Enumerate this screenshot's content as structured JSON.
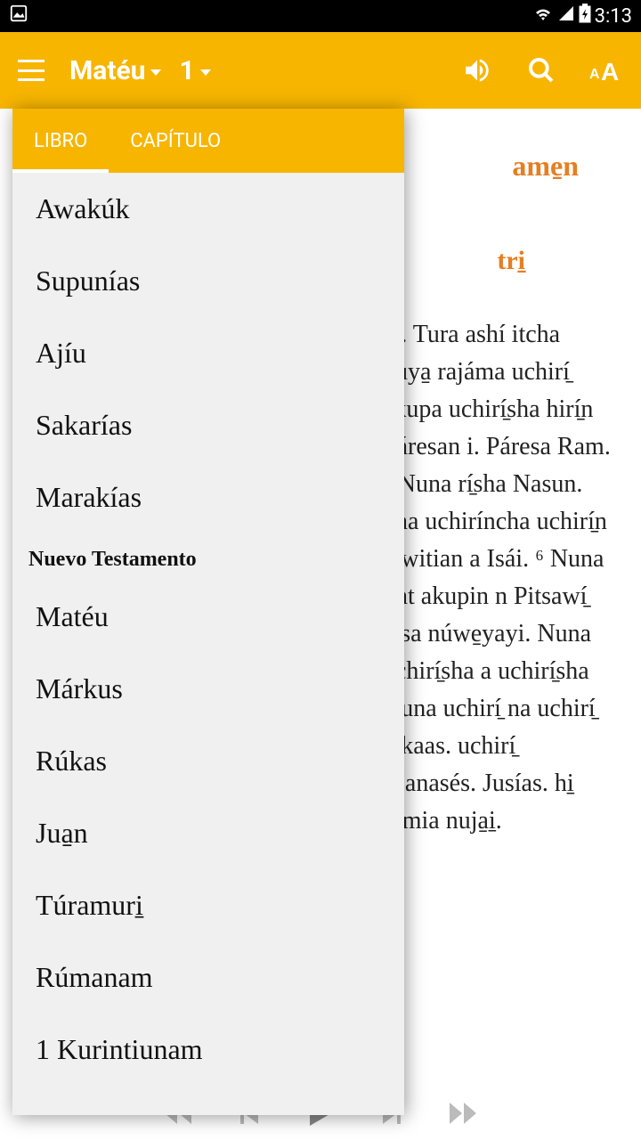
{
  "status": {
    "time": "3:13"
  },
  "toolbar": {
    "book": "Matéu",
    "chapter": "1"
  },
  "tabs": {
    "libro": "LIBRO",
    "capitulo": "CAPÍTULO"
  },
  "sectionHeader": "Nuevo Testamento",
  "books": [
    "Awakúk",
    "Supunías",
    "Ajíu",
    "Sakarías",
    "Marakías",
    "Matéu",
    "Márkus",
    "Rúkas",
    "Jua̱n",
    "Túramuri̱",
    "Rúmanam",
    "1 Kurintiunam"
  ],
  "content": {
    "h1": "ame̱n",
    "h2": "tri̱",
    "body": "ai. Tura ashí itcha nuya̱ rajáma uchirí̱ akupa uchirí̱sha hirí̱n Páresan i. Páresa Ram. ⁴ Nuna rí̱sha Nasun. una uchiríncha uchirí̱n Uwitian a Isái. ⁶ Nuna unt akupin n Pitsawí̱ íasa núwe̱yayi. Nuna uchirí̱sha a uchirí̱sha Nuna uchirí̱ na uchirí̱ Akaas. uchirí̱ Manasés. Jusías. hi̱ armia nuja̱i̱."
  }
}
